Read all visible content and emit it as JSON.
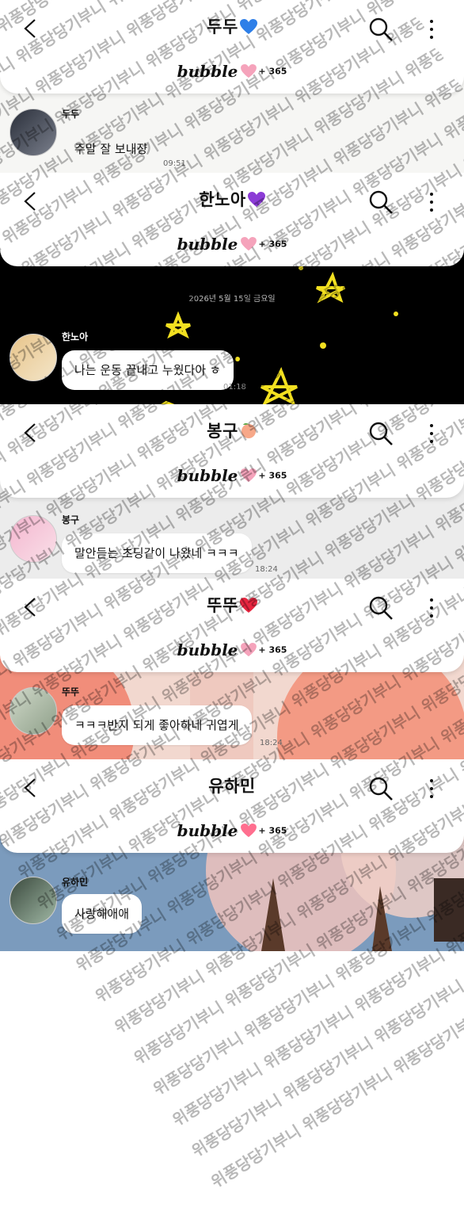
{
  "watermark": "위풍당당기부니",
  "logo": "bubble",
  "days_label": "+ 365",
  "panels": [
    {
      "title": "두두",
      "heart_color": "#2e7fe8",
      "sender": "두두",
      "message": "주말 잘 보내쟝",
      "time": "09:51",
      "bg": "#f6f6f4"
    },
    {
      "title": "한노아",
      "heart_color": "#8b3bd6",
      "sender": "한노아",
      "message": "나는 운동 끝내고 누웠다아 ㅎ",
      "time": "01:18",
      "date": "2026년 5월 15일 금요일",
      "bg": "#000000"
    },
    {
      "title": "봉구",
      "heart_color": "#f3a07b",
      "sender": "봉구",
      "message": "말안듣는 초딩같이 나왔네 ㅋㅋㅋ",
      "time": "18:24",
      "bg": "#ececec"
    },
    {
      "title": "뚜뚜",
      "heart_color": "#e8253f",
      "sender": "뚜뚜",
      "message": "ㅋㅋㅋ반지 되게 좋아하네 귀엽게",
      "time": "18:24",
      "bg": "#f2d8cf"
    },
    {
      "title": "유하민",
      "heart_color": "#ff6f8f",
      "sender": "유하민",
      "message": "사랑해애애",
      "time": "",
      "bg": "#6c8fb0"
    }
  ]
}
